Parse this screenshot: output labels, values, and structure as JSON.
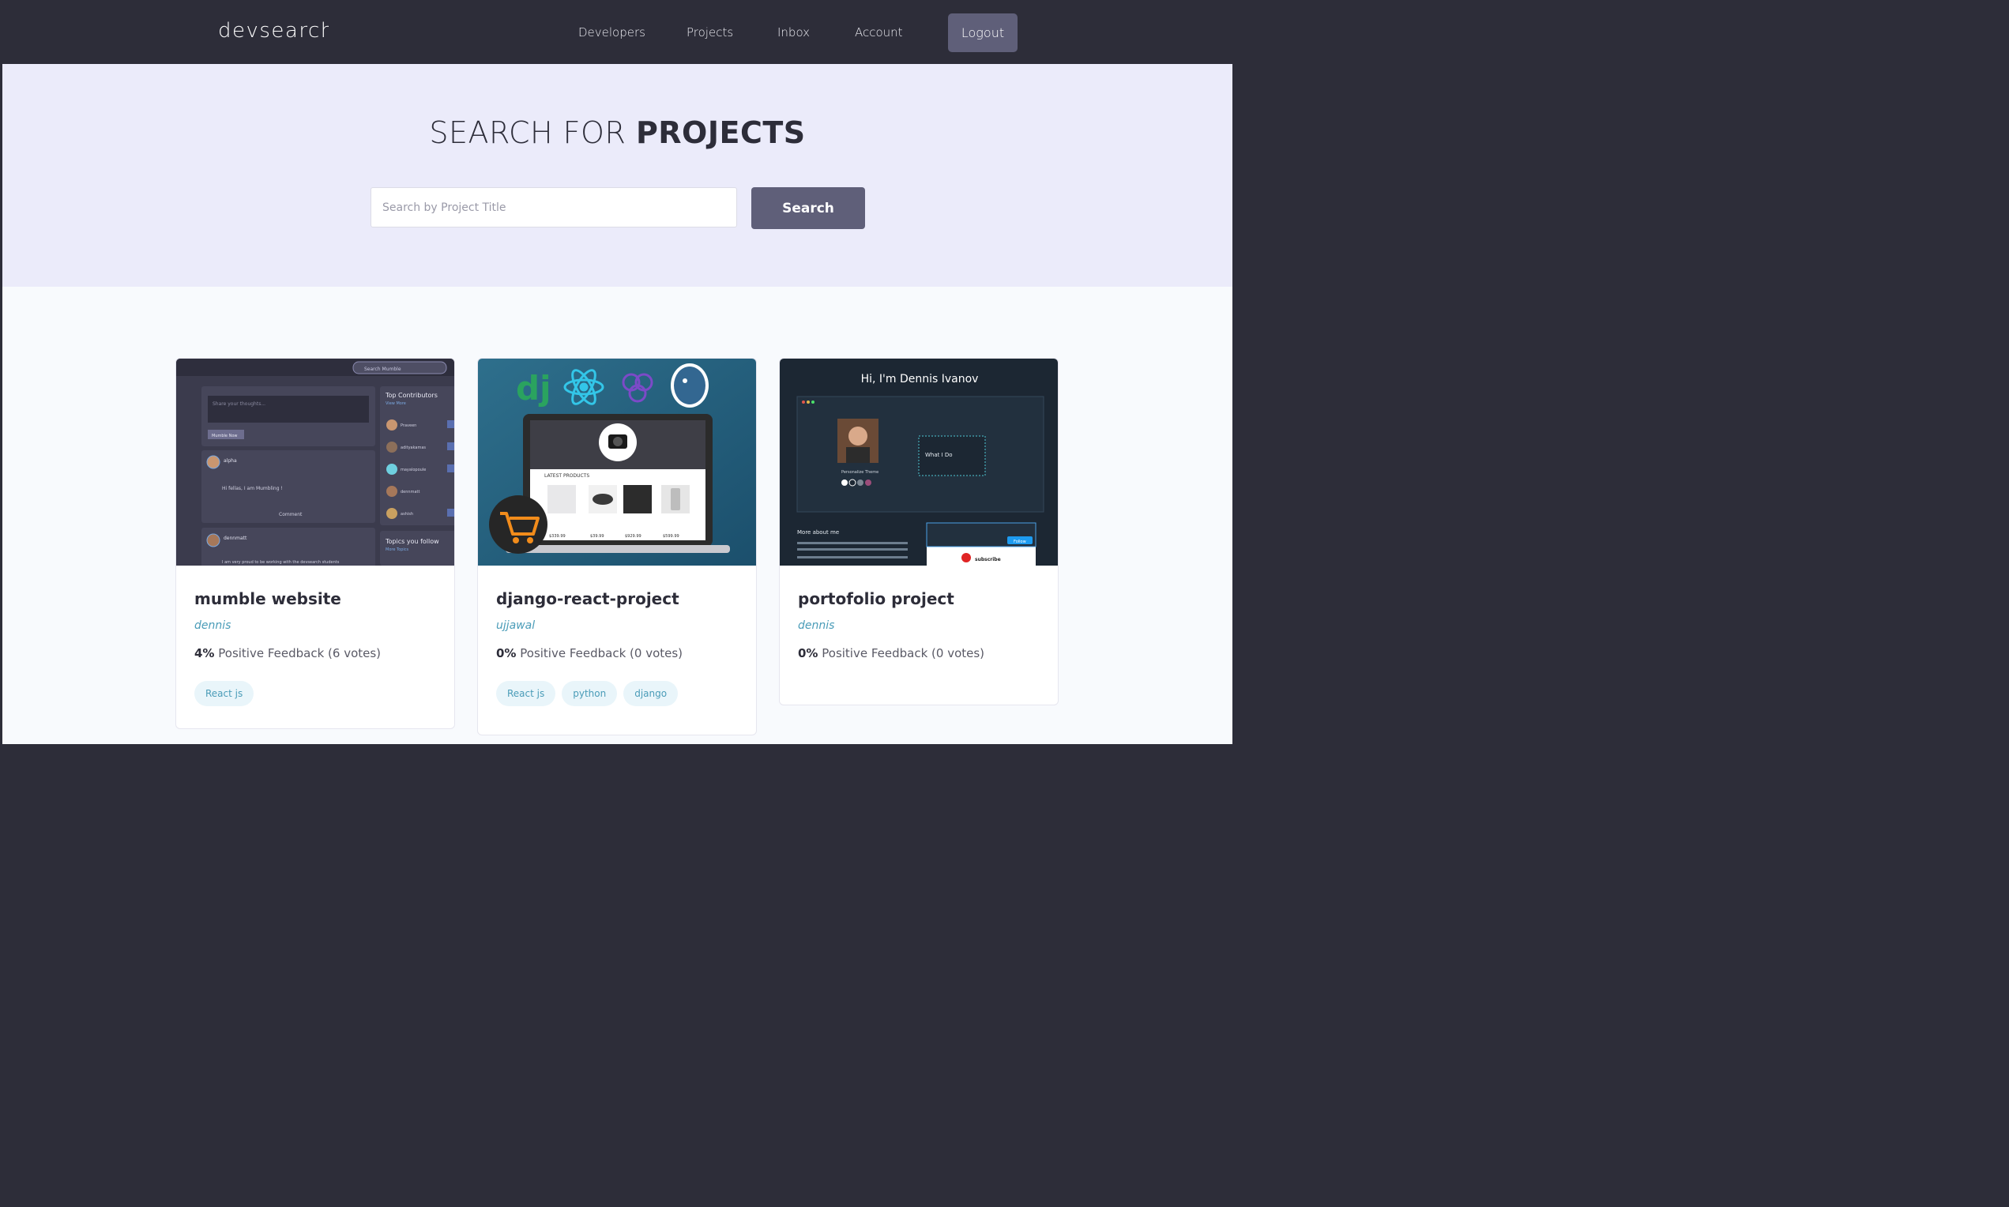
{
  "header": {
    "logo": "devsearch",
    "nav": [
      "Developers",
      "Projects",
      "Inbox",
      "Account"
    ],
    "logout": "Logout"
  },
  "hero": {
    "title_light": "SEARCH FOR ",
    "title_bold": "PROJECTS",
    "search_placeholder": "Search by Project Title",
    "search_button": "Search"
  },
  "projects": [
    {
      "title": "mumble website",
      "owner": "dennis",
      "feedback_pct": "4%",
      "feedback_text": "Positive Feedback (6 votes)",
      "tags": [
        "React js"
      ],
      "thumb": {
        "search": "Search Mumble",
        "contributors_title": "Top Contributors",
        "contributors_link": "View More",
        "contributors": [
          "Praveen",
          "adityakamas",
          "mayalopoule",
          "dennmatt",
          "ashish"
        ],
        "topics_title": "Topics you follow",
        "topics_link": "More Topics",
        "post_placeholder": "Share your thoughts...",
        "post_button": "Mumble Now",
        "post1_user": "alpha",
        "post1_text": "Hi fellas, I am Mumbling !",
        "post2_user": "dennmatt",
        "post2_text": "I am very proud to be working with the devsearch students",
        "comment": "Comment"
      }
    },
    {
      "title": "django-react-project",
      "owner": "ujjawal",
      "feedback_pct": "0%",
      "feedback_text": "Positive Feedback (0 votes)",
      "tags": [
        "React js",
        "python",
        "django"
      ],
      "thumb": {
        "dj": "dj",
        "latest": "LATEST PRODUCTS",
        "prices": [
          "$339.99",
          "$39.99",
          "$929.99",
          "$599.99"
        ]
      }
    },
    {
      "title": "portofolio project",
      "owner": "dennis",
      "feedback_pct": "0%",
      "feedback_text": "Positive Feedback (0 votes)",
      "tags": [],
      "thumb": {
        "heading": "Hi, I'm Dennis Ivanov",
        "theme_label": "Personalize Theme",
        "what_i_do": "What I Do",
        "more_about": "More about me",
        "follow": "Follow",
        "subscribe": "subscribe"
      }
    }
  ],
  "colors": {
    "header_bg": "#2d2d39",
    "hero_bg": "#ebebfa",
    "button_bg": "#5f5f79",
    "accent": "#4a9cb8",
    "tag_bg": "#e9f5fa"
  }
}
